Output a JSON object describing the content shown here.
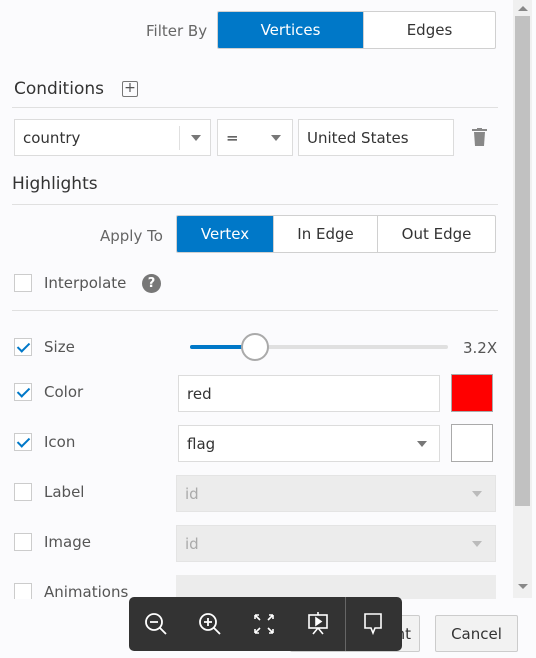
{
  "filter": {
    "label": "Filter By",
    "options": [
      "Vertices",
      "Edges"
    ],
    "selected": "Vertices"
  },
  "conditions": {
    "title": "Conditions",
    "property": "country",
    "operator": "=",
    "value": "United States"
  },
  "highlights": {
    "title": "Highlights",
    "apply_to_label": "Apply To",
    "apply_options": [
      "Vertex",
      "In Edge",
      "Out Edge"
    ],
    "selected": "Vertex",
    "interpolate": {
      "label": "Interpolate",
      "checked": false
    },
    "size": {
      "label": "Size",
      "checked": true,
      "value": "3.2X",
      "slider_fraction": 0.25
    },
    "color": {
      "label": "Color",
      "checked": true,
      "value": "red",
      "swatch": "#ff0000"
    },
    "icon": {
      "label": "Icon",
      "checked": true,
      "value": "flag"
    },
    "label": {
      "label": "Label",
      "checked": false,
      "value": "id"
    },
    "image": {
      "label": "Image",
      "checked": false,
      "value": "id"
    },
    "animations": {
      "label": "Animations",
      "checked": false
    }
  },
  "footer": {
    "partial_button": "nt",
    "cancel": "Cancel"
  },
  "toolbar": [
    "zoom-out",
    "zoom-in",
    "fit-to-screen",
    "presentation",
    "comment"
  ],
  "colors": {
    "accent": "#0078c8"
  }
}
